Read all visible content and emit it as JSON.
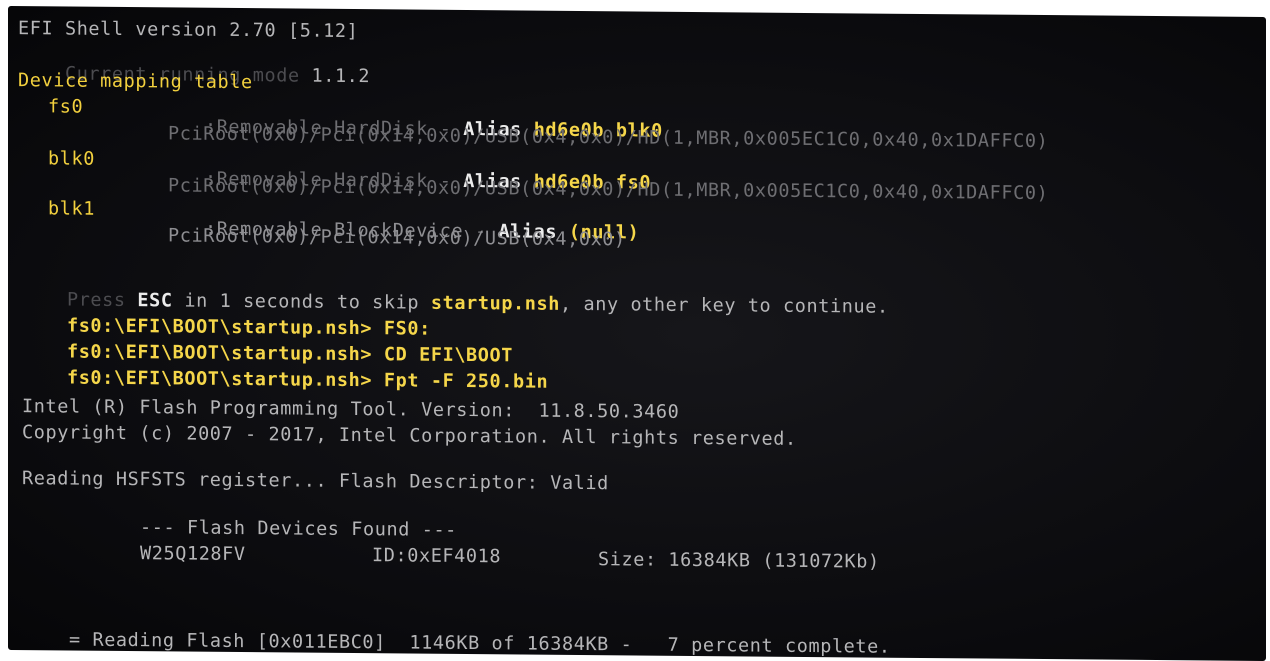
{
  "shell": {
    "title": "EFI Shell version 2.70 [5.12]",
    "running_mode_label": "Current running mode",
    "running_mode_value": "1.1.2",
    "mapping_title": "Device mapping table"
  },
  "mappings": [
    {
      "name": "fs0",
      "type": ":Removable HardDisk",
      "dash": "-",
      "alias_label": "Alias",
      "alias_value": "hd6e0b blk0",
      "path": "PciRoot(0x0)/Pci(0x14,0x0)/USB(0x4,0x0)/HD(1,MBR,0x005EC1C0,0x40,0x1DAFFC0)"
    },
    {
      "name": "blk0",
      "type": ":Removable HardDisk",
      "dash": "-",
      "alias_label": "Alias",
      "alias_value": "hd6e0b fs0",
      "path": "PciRoot(0x0)/Pci(0x14,0x0)/USB(0x4,0x0)/HD(1,MBR,0x005EC1C0,0x40,0x1DAFFC0)"
    },
    {
      "name": "blk1",
      "type": ":Removable BlockDevice",
      "dash": "-",
      "alias_label": "Alias",
      "alias_value": "(null)",
      "path": "PciRoot(0x0)/Pci(0x14,0x0)/USB(0x4,0x0)"
    }
  ],
  "startup": {
    "press": "Press",
    "esc": "ESC",
    "in_seconds": "in 1 seconds to skip",
    "script": "startup.nsh",
    "rest": ", any other key to continue."
  },
  "commands": [
    {
      "prompt": "fs0:\\EFI\\BOOT\\startup.nsh>",
      "cmd": "FS0:"
    },
    {
      "prompt": "fs0:\\EFI\\BOOT\\startup.nsh>",
      "cmd": "CD EFI\\BOOT"
    },
    {
      "prompt": "fs0:\\EFI\\BOOT\\startup.nsh>",
      "cmd": "Fpt -F 250.bin"
    }
  ],
  "fpt": {
    "tool_line": "Intel (R) Flash Programming Tool. Version:  11.8.50.3460",
    "copyright": "Copyright (c) 2007 - 2017, Intel Corporation. All rights reserved.",
    "hsfsts": "Reading HSFSTS register... Flash Descriptor: Valid",
    "devices_header": "--- Flash Devices Found ---",
    "device_name": "W25Q128FV",
    "device_id": "ID:0xEF4018",
    "device_size": "Size: 16384KB (131072Kb)"
  },
  "progress": {
    "spinner": "=",
    "text": "Reading Flash [0x011EBC0]  1146KB of 16384KB -   7 percent complete.",
    "percent": 7
  }
}
